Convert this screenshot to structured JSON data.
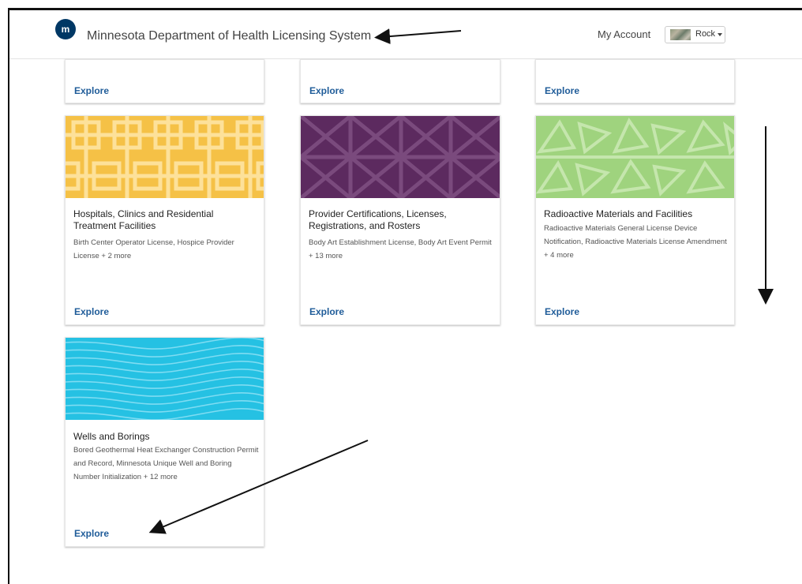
{
  "header": {
    "title": "Minnesota Department of Health Licensing System",
    "logo_text": "m",
    "my_account": "My Account",
    "user_name": "Rock"
  },
  "cards": [
    {
      "explore": "Explore"
    },
    {
      "explore": "Explore"
    },
    {
      "explore": "Explore"
    },
    {
      "title": "Hospitals, Clinics and Residential Treatment Facilities",
      "description": "Birth Center Operator License, Hospice Provider License + 2 more",
      "explore": "Explore",
      "color": "#f5c146"
    },
    {
      "title": "Provider Certifications, Licenses, Registrations, and Rosters",
      "description": "Body Art Establishment License, Body Art Event Permit + 13 more",
      "explore": "Explore",
      "color": "#5c2a5f"
    },
    {
      "title": "Radioactive Materials and Facilities",
      "description": "Radioactive Materials General License Device Notification, Radioactive Materials License Amendment + 4 more",
      "explore": "Explore",
      "color": "#9fd37e"
    },
    {
      "title": "Wells and Borings",
      "description": "Bored Geothermal Heat Exchanger Construction Permit and Record, Minnesota Unique Well and Boring Number Initialization + 12 more",
      "explore": "Explore",
      "color": "#25c1e3"
    }
  ]
}
